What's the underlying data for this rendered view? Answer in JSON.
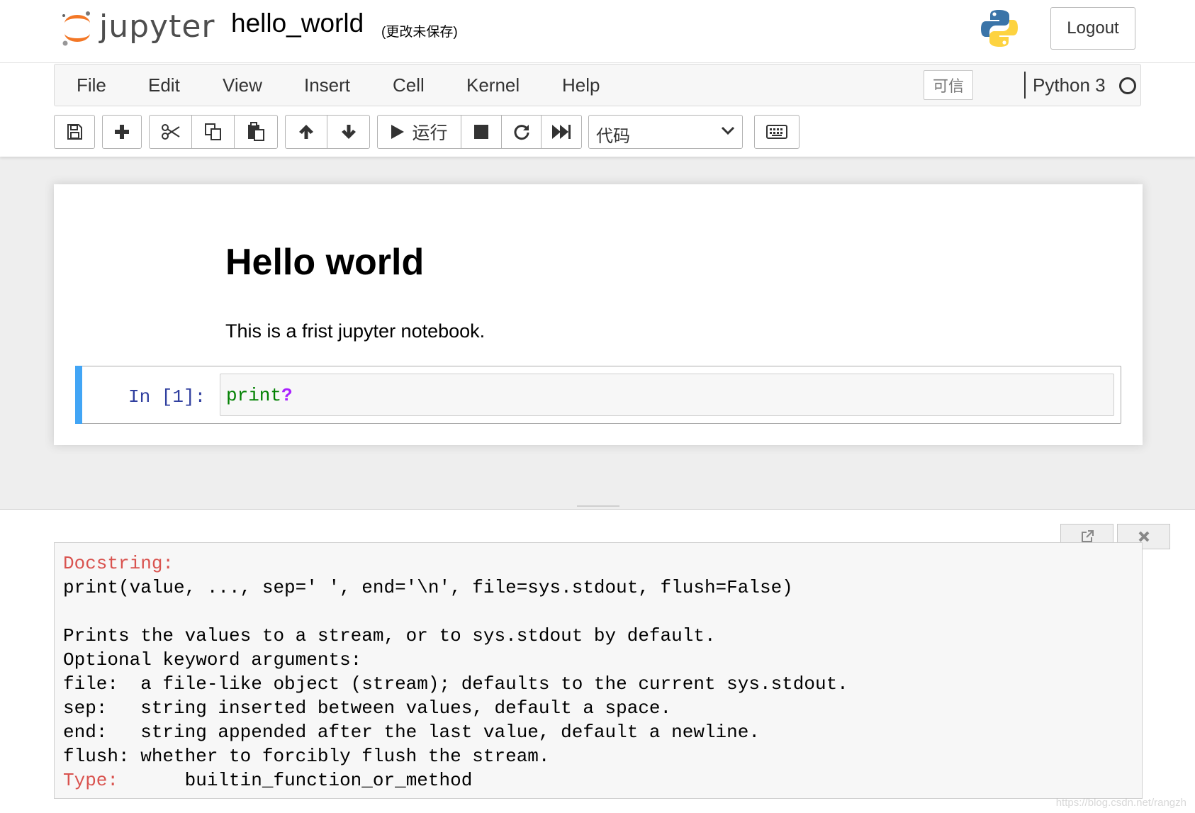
{
  "header": {
    "logo_text": "jupyter",
    "notebook_name": "hello_world",
    "save_status": "(更改未保存)",
    "logout_label": "Logout"
  },
  "menubar": {
    "items": [
      "File",
      "Edit",
      "View",
      "Insert",
      "Cell",
      "Kernel",
      "Help"
    ],
    "trusted_label": "可信",
    "kernel_name": "Python 3",
    "kernel_status": "idle"
  },
  "toolbar": {
    "buttons": [
      "save-icon",
      "plus-icon",
      "cut-icon",
      "copy-icon",
      "paste-icon",
      "arrow-up-icon",
      "arrow-down-icon",
      "play-icon",
      "stop-icon",
      "restart-icon",
      "fast-forward-icon",
      "keyboard-icon"
    ],
    "run_label": "运行",
    "cell_type": "代码"
  },
  "notebook": {
    "markdown": {
      "heading": "Hello world",
      "paragraph": "This is a frist jupyter notebook."
    },
    "code_cell": {
      "prompt": "In [1]:",
      "code_fn": "print",
      "code_op": "?"
    }
  },
  "pager": {
    "docstring_label": "Docstring:",
    "signature": "print(value, ..., sep=' ', end='\\n', file=sys.stdout, flush=False)",
    "description": "Prints the values to a stream, or to sys.stdout by default.",
    "optional_header": "Optional keyword arguments:",
    "params": [
      "file:  a file-like object (stream); defaults to the current sys.stdout.",
      "sep:   string inserted between values, default a space.",
      "end:   string appended after the last value, default a newline.",
      "flush: whether to forcibly flush the stream."
    ],
    "type_label": "Type:",
    "type_value": "builtin_function_or_method"
  },
  "watermark": "https://blog.csdn.net/rangzh",
  "colors": {
    "accent_blue": "#42a5f5",
    "prompt_blue": "#303f9f",
    "code_green": "#008000",
    "operator_purple": "#aa22ff",
    "docstring_red": "#d9534f",
    "jupyter_orange": "#f37726"
  }
}
